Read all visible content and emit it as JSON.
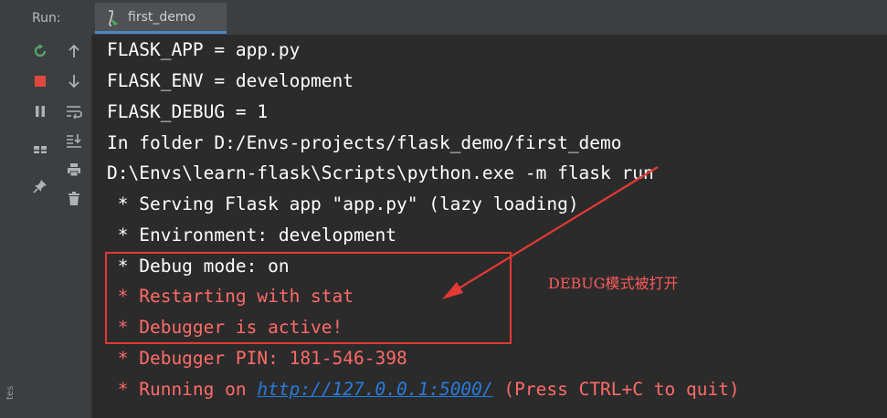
{
  "header": {
    "run_label": "Run:",
    "tab_label": "first_demo"
  },
  "sidebar_edge_text": "tes",
  "toolbar": {
    "left_icons": [
      "rerun-icon",
      "stop-icon",
      "pause-icon",
      "layout-icon",
      "pin-icon"
    ],
    "right_icons": [
      "arrow-up-icon",
      "arrow-down-icon",
      "soft-wrap-icon",
      "scroll-to-end-icon",
      "print-icon",
      "trash-icon"
    ]
  },
  "console": {
    "lines": [
      {
        "text": "FLASK_APP = app.py"
      },
      {
        "text": "FLASK_ENV = development"
      },
      {
        "text": "FLASK_DEBUG = 1"
      },
      {
        "text": "In folder D:/Envs-projects/flask_demo/first_demo"
      },
      {
        "text": "D:\\Envs\\learn-flask\\Scripts\\python.exe -m flask run"
      },
      {
        "text": " * Serving Flask app \"app.py\" (lazy loading)"
      },
      {
        "text": " * Environment: development"
      },
      {
        "text": " * Debug mode: on"
      },
      {
        "text": " * Restarting with stat"
      },
      {
        "text": " * Debugger is active!"
      },
      {
        "text": " * Debugger PIN: 181-546-398"
      }
    ],
    "last_line": {
      "prefix": " * Running on ",
      "url": "http://127.0.0.1:5000/",
      "suffix": " (Press CTRL+C to quit)"
    }
  },
  "annotation": {
    "text": "DEBUG模式被打开"
  },
  "colors": {
    "console_bg": "#2b2b2b",
    "stderr_red": "#ff6b68",
    "link_blue": "#287bde",
    "annotation_red": "#e53935"
  }
}
